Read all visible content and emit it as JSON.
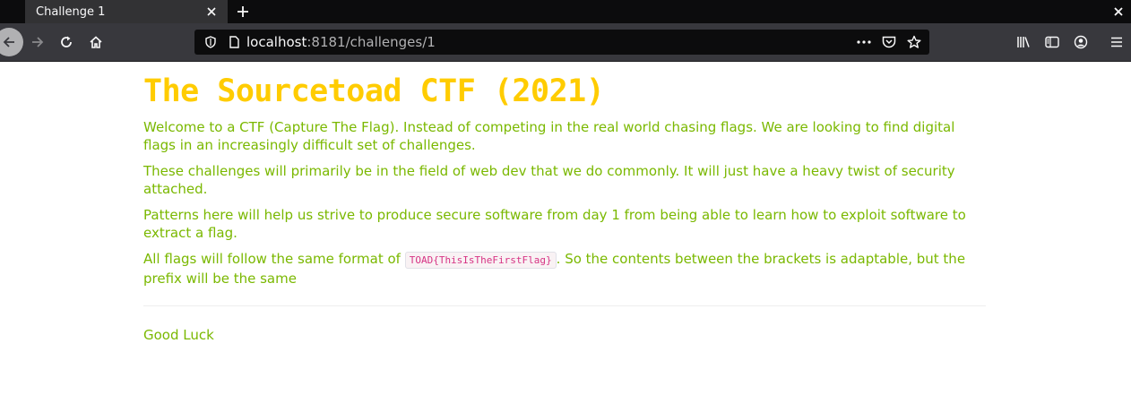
{
  "browser": {
    "tab_title": "Challenge 1",
    "url_host": "localhost",
    "url_rest": ":8181/challenges/1",
    "theme": {
      "chrome_dark": "#0c0c0d",
      "toolbar": "#38383d",
      "tab_active": "#323234",
      "icon": "#f9f9fa"
    },
    "icons": {
      "tab_close": "close-icon",
      "new_tab": "plus-icon",
      "window_close": "close-icon",
      "back": "back-arrow-icon",
      "forward": "forward-arrow-icon",
      "reload": "reload-icon",
      "home": "home-icon",
      "tracking": "shield-icon",
      "page_info": "page-icon",
      "page_actions": "more-icon",
      "pocket": "pocket-icon",
      "bookmark": "star-icon",
      "library": "library-icon",
      "sidebar": "sidebar-icon",
      "account": "account-icon",
      "menu": "hamburger-icon"
    }
  },
  "page": {
    "title": "The Sourcetoad CTF (2021)",
    "paragraphs": {
      "p1": "Welcome to a CTF (Capture The Flag). Instead of competing in the real world chasing flags. We are looking to find digital flags in an increasingly difficult set of challenges.",
      "p2": "These challenges will primarily be in the field of web dev that we do commonly. It will just have a heavy twist of security attached.",
      "p3": "Patterns here will help us strive to produce secure software from day 1 from being able to learn how to exploit software to extract a flag.",
      "p4_before": "All flags will follow the same format of ",
      "p4_code": "TOAD{ThisIsTheFirstFlag}",
      "p4_after": ". So the contents between the brackets is adaptable, but the prefix will be the same"
    },
    "signoff": "Good Luck",
    "colors": {
      "title": "#ffcc00",
      "text": "#7ab800",
      "code": "#d63384"
    }
  }
}
